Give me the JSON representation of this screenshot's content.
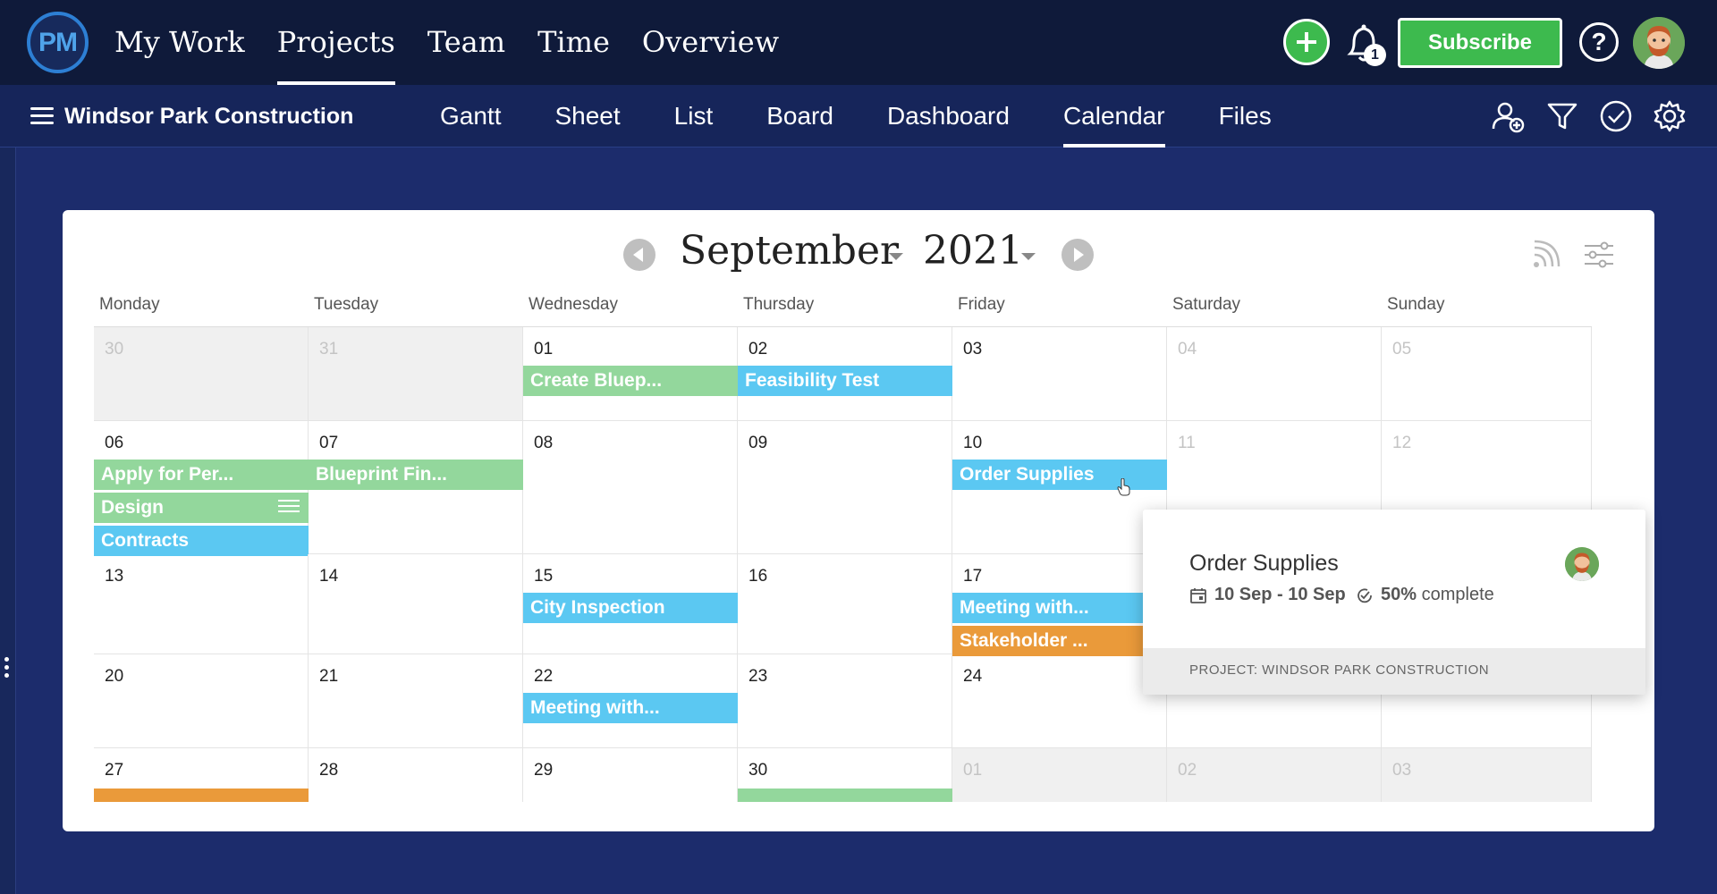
{
  "app": {
    "logo_text": "PM",
    "nav": [
      "My Work",
      "Projects",
      "Team",
      "Time",
      "Overview"
    ],
    "active_nav": "Projects",
    "notifications_count": "1",
    "subscribe_label": "Subscribe",
    "help_label": "?"
  },
  "project": {
    "name": "Windsor Park Construction",
    "views": [
      "Gantt",
      "Sheet",
      "List",
      "Board",
      "Dashboard",
      "Calendar",
      "Files"
    ],
    "active_view": "Calendar"
  },
  "calendar": {
    "month": "September",
    "year": "2021",
    "weekdays": [
      "Monday",
      "Tuesday",
      "Wednesday",
      "Thursday",
      "Friday",
      "Saturday",
      "Sunday"
    ],
    "weeks": [
      [
        "30",
        "31",
        "01",
        "02",
        "03",
        "04",
        "05"
      ],
      [
        "06",
        "07",
        "08",
        "09",
        "10",
        "11",
        "12"
      ],
      [
        "13",
        "14",
        "15",
        "16",
        "17",
        "",
        ""
      ],
      [
        "20",
        "21",
        "22",
        "23",
        "24",
        "",
        ""
      ],
      [
        "27",
        "28",
        "29",
        "30",
        "01",
        "02",
        "03"
      ]
    ],
    "events": {
      "create_blueprint": "Create Bluep...",
      "feasibility_test": "Feasibility Test",
      "apply_for_permits": "Apply for Per...",
      "blueprint_finalize": "Blueprint Fin...",
      "order_supplies": "Order Supplies",
      "design": "Design",
      "contracts": "Contracts",
      "city_inspection": "City Inspection",
      "meeting_17": "Meeting with...",
      "stakeholder": "Stakeholder ...",
      "meeting_22": "Meeting with..."
    },
    "colors": {
      "green": "#93d79c",
      "blue": "#5bc8f2",
      "orange": "#ea9a3a"
    }
  },
  "popover": {
    "title": "Order Supplies",
    "dates": "10 Sep - 10 Sep",
    "percent": "50%",
    "complete_label": "complete",
    "project_label": "PROJECT: WINDSOR PARK CONSTRUCTION"
  }
}
